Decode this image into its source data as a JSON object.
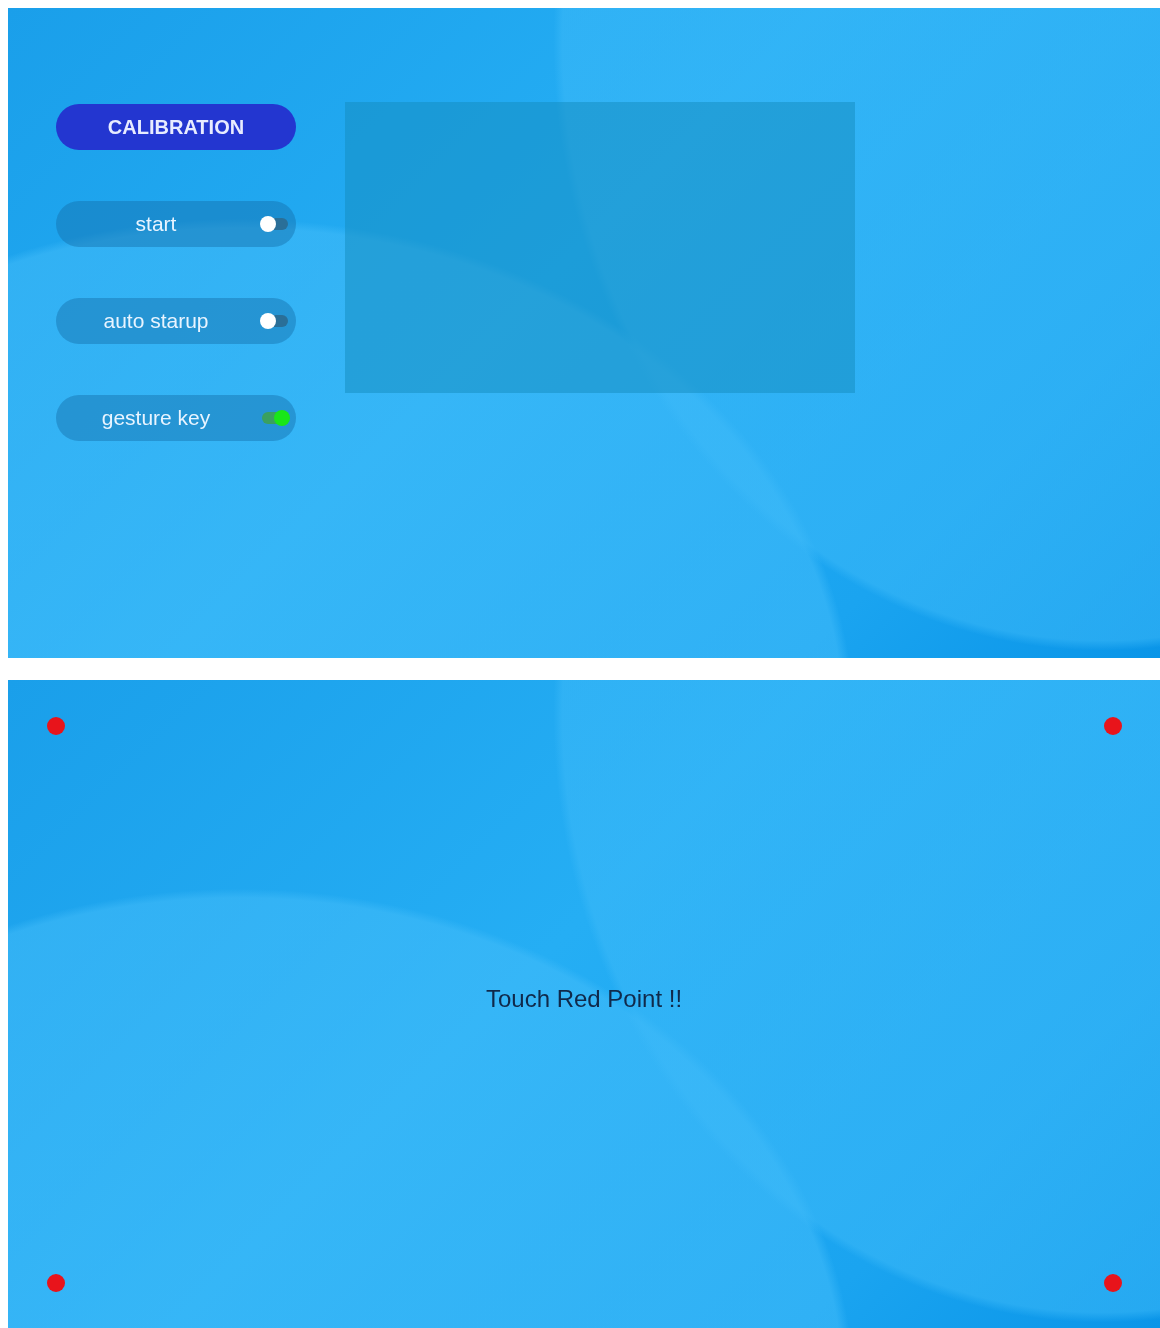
{
  "settings_screen": {
    "calibration_button": "CALIBRATION",
    "switches": [
      {
        "label": "start",
        "on": false
      },
      {
        "label": "auto starup",
        "on": false
      },
      {
        "label": "gesture key",
        "on": true
      }
    ]
  },
  "calibration_screen": {
    "prompt": "Touch Red Point !!"
  }
}
